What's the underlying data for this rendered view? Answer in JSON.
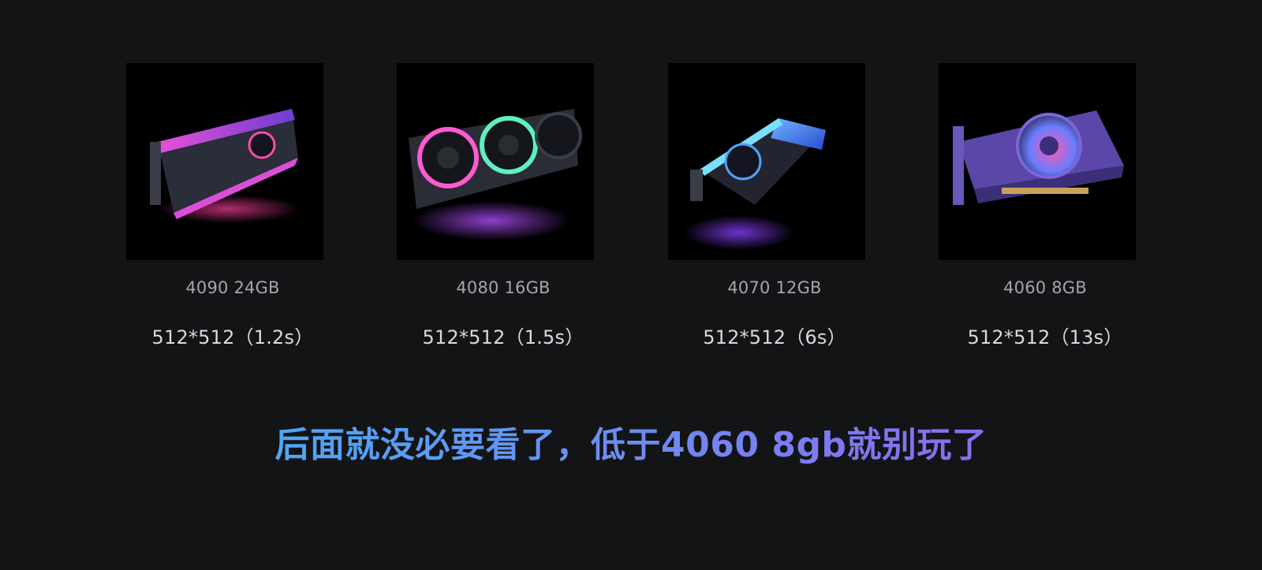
{
  "cards": [
    {
      "model": "4090 24GB",
      "timing": "512*512（1.2s）"
    },
    {
      "model": "4080 16GB",
      "timing": "512*512（1.5s）"
    },
    {
      "model": "4070 12GB",
      "timing": "512*512（6s）"
    },
    {
      "model": "4060 8GB",
      "timing": "512*512（13s）"
    }
  ],
  "banner": {
    "text": "后面就没必要看了，低于4060 8gb就别玩了"
  },
  "colors": {
    "background": "#131416",
    "model_text": "#a3a6ab",
    "timing_text": "#d8dadd",
    "banner_gradient_start": "#4ea6f5",
    "banner_gradient_end": "#8a6cf0"
  }
}
